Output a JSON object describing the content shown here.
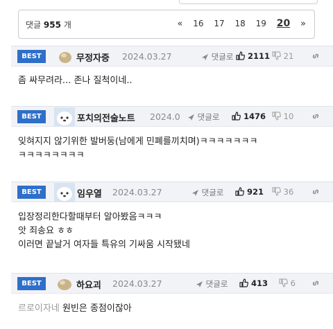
{
  "comment_count": {
    "label": "댓글",
    "value": "955",
    "unit": "개"
  },
  "pagination": {
    "first": "«",
    "pages": [
      "16",
      "17",
      "18",
      "19"
    ],
    "current": "20",
    "next": "»"
  },
  "comments": [
    {
      "badge": "BEST",
      "author": "무정자증",
      "date": "2024.03.27",
      "reply_label": "댓글로",
      "likes": "2111",
      "dislikes": "21",
      "lines": [
        "좀 싸무려라... 존나 질척이네.."
      ],
      "avatar": "beige-blob"
    },
    {
      "badge": "BEST",
      "author": "포치의전술노트",
      "date": "2024.0",
      "reply_label": "댓글로",
      "likes": "1476",
      "dislikes": "10",
      "lines": [
        "잊혀지지 않기위한 발버둥(남에게 민폐를끼치며)ㅋㅋㅋㅋㅋㅋㅋ",
        "ㅋㅋㅋㅋㅋㅋㅋㅋ"
      ],
      "avatar": "white-dog"
    },
    {
      "badge": "BEST",
      "author": "임우열",
      "date": "2024.03.27",
      "reply_label": "댓글로",
      "likes": "921",
      "dislikes": "36",
      "lines": [
        "입장정리한다할때부터 알아봤음ㅋㅋㅋ",
        "앗 죄송요 ㅎㅎ",
        "이러면 끝날거 여자들 특유의 기싸움 시작됐네"
      ],
      "avatar": "white-dog"
    },
    {
      "badge": "BEST",
      "author": "하요괴",
      "date": "2024.03.27",
      "reply_label": "댓글로",
      "likes": "413",
      "dislikes": "6",
      "mention": "르로이자네",
      "lines": [
        "원빈은 종점이잖아"
      ],
      "avatar": "beige-blob"
    }
  ],
  "colors": {
    "best_badge": "#2e6fc9",
    "header_bg": "#f2f3f7"
  }
}
